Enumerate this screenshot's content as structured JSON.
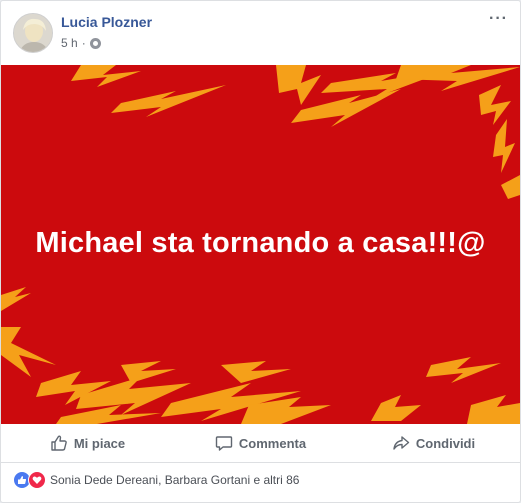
{
  "post": {
    "author": "Lucia Plozner",
    "time": "5 h",
    "privacy_icon": "globe-icon",
    "more_icon": "more-options-icon",
    "more_label": "···"
  },
  "image": {
    "text": "Michael sta tornando a casa!!!@",
    "background_color": "#cc0a0d",
    "accent_color": "#f5a019"
  },
  "actions": {
    "like_label": "Mi piace",
    "comment_label": "Commenta",
    "share_label": "Condividi"
  },
  "reactions": {
    "icons": [
      "like-reaction-icon",
      "love-reaction-icon"
    ],
    "summary": "Sonia Dede Dereani, Barbara Gortani e altri 86"
  }
}
